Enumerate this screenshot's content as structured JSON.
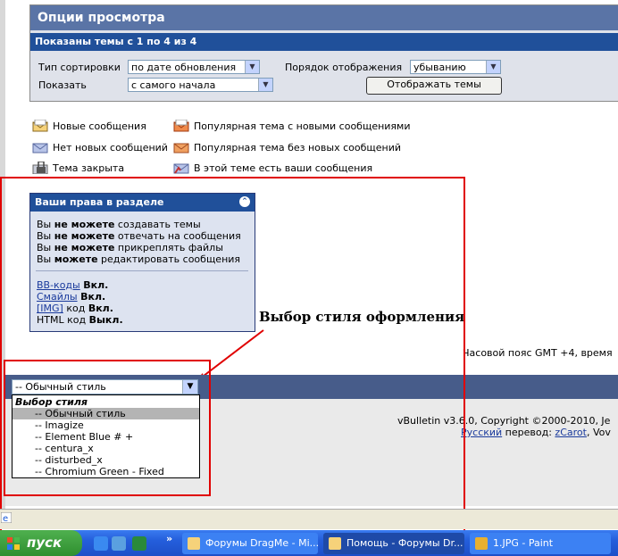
{
  "options": {
    "title": "Опции просмотра",
    "subtitle": "Показаны темы с 1 по 4 из 4",
    "sort_label": "Тип сортировки",
    "sort_value": "по дате обновления",
    "order_label": "Порядок отображения",
    "order_value": "убыванию",
    "show_label": "Показать",
    "show_value": "с самого начала",
    "show_button": "Отображать темы"
  },
  "legend": [
    {
      "label": "Новые сообщения",
      "icon": "new-posts-icon"
    },
    {
      "label": "Нет новых сообщений",
      "icon": "no-new-posts-icon"
    },
    {
      "label": "Тема закрыта",
      "icon": "closed-thread-icon"
    },
    {
      "label": "Популярная тема с новыми сообщениями",
      "icon": "hot-new-icon"
    },
    {
      "label": "Популярная тема без новых сообщений",
      "icon": "hot-icon"
    },
    {
      "label": "В этой теме есть ваши сообщения",
      "icon": "own-posts-icon"
    }
  ],
  "rights": {
    "title": "Ваши права в разделе",
    "lines": [
      {
        "pre": "Вы ",
        "bold": "не можете",
        "post": " создавать темы"
      },
      {
        "pre": "Вы ",
        "bold": "не можете",
        "post": " отвечать на сообщения"
      },
      {
        "pre": "Вы ",
        "bold": "не можете",
        "post": " прикреплять файлы"
      },
      {
        "pre": "Вы ",
        "bold": "можете",
        "post": " редактировать сообщения"
      }
    ],
    "codes": [
      {
        "link": "BB-коды",
        "text": "",
        "state": "Вкл."
      },
      {
        "link": "Смайлы",
        "text": "",
        "state": "Вкл."
      },
      {
        "link": "[IMG]",
        "text": " код ",
        "state": "Вкл."
      },
      {
        "link": "",
        "text": "HTML код ",
        "state": "Выкл."
      }
    ]
  },
  "annotation": "Выбор стиля оформления",
  "timezone": "Часовой пояс GMT +4, время",
  "style_select": {
    "value": "-- Обычный стиль",
    "header": "Выбор стиля",
    "options": [
      "-- Обычный стиль",
      "-- Imagize",
      "-- Element Blue # +",
      "-- centura_x",
      "-- disturbed_x",
      "-- Chromium Green - Fixed"
    ],
    "selected_index": 0
  },
  "copyright": {
    "line1": "vBulletin v3.6.0, Copyright ©2000-2010, Je",
    "line2_link1": "Русский",
    "line2_text": " перевод: ",
    "line2_link2": "zCarot",
    "line2_tail": ", Vov"
  },
  "taskbar": {
    "start": "пуск",
    "tasks": [
      "Форумы DragMe - Mi...",
      "Помощь - Форумы Dr...",
      "1.JPG - Paint"
    ]
  },
  "colors": {
    "header_blue": "#5a74a6",
    "dark_blue": "#20509a",
    "annotation_red": "#e00000"
  }
}
